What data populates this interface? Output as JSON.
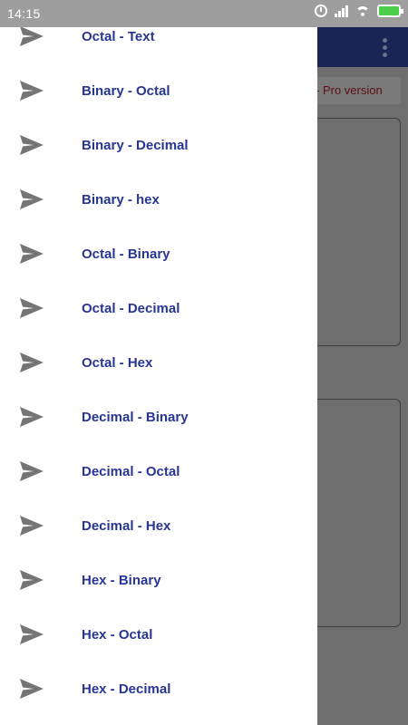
{
  "status_bar": {
    "time": "14:15",
    "icons": [
      "alarm-icon",
      "signal-icon",
      "wifi-icon",
      "battery-charging-icon"
    ]
  },
  "background_app": {
    "toolbar_color": "#1a2556",
    "overflow_icon": "more-vert-icon",
    "pro_label": "- Pro version"
  },
  "drawer": {
    "accent_color": "#283593",
    "icon_color": "#757575",
    "items": [
      {
        "label": "Octal - Text",
        "icon": "send-icon"
      },
      {
        "label": "Binary - Octal",
        "icon": "send-icon"
      },
      {
        "label": "Binary - Decimal",
        "icon": "send-icon"
      },
      {
        "label": "Binary - hex",
        "icon": "send-icon"
      },
      {
        "label": "Octal - Binary",
        "icon": "send-icon"
      },
      {
        "label": "Octal - Decimal",
        "icon": "send-icon"
      },
      {
        "label": "Octal - Hex",
        "icon": "send-icon"
      },
      {
        "label": "Decimal - Binary",
        "icon": "send-icon"
      },
      {
        "label": "Decimal - Octal",
        "icon": "send-icon"
      },
      {
        "label": "Decimal - Hex",
        "icon": "send-icon"
      },
      {
        "label": "Hex - Binary",
        "icon": "send-icon"
      },
      {
        "label": "Hex - Octal",
        "icon": "send-icon"
      },
      {
        "label": "Hex - Decimal",
        "icon": "send-icon"
      }
    ]
  }
}
